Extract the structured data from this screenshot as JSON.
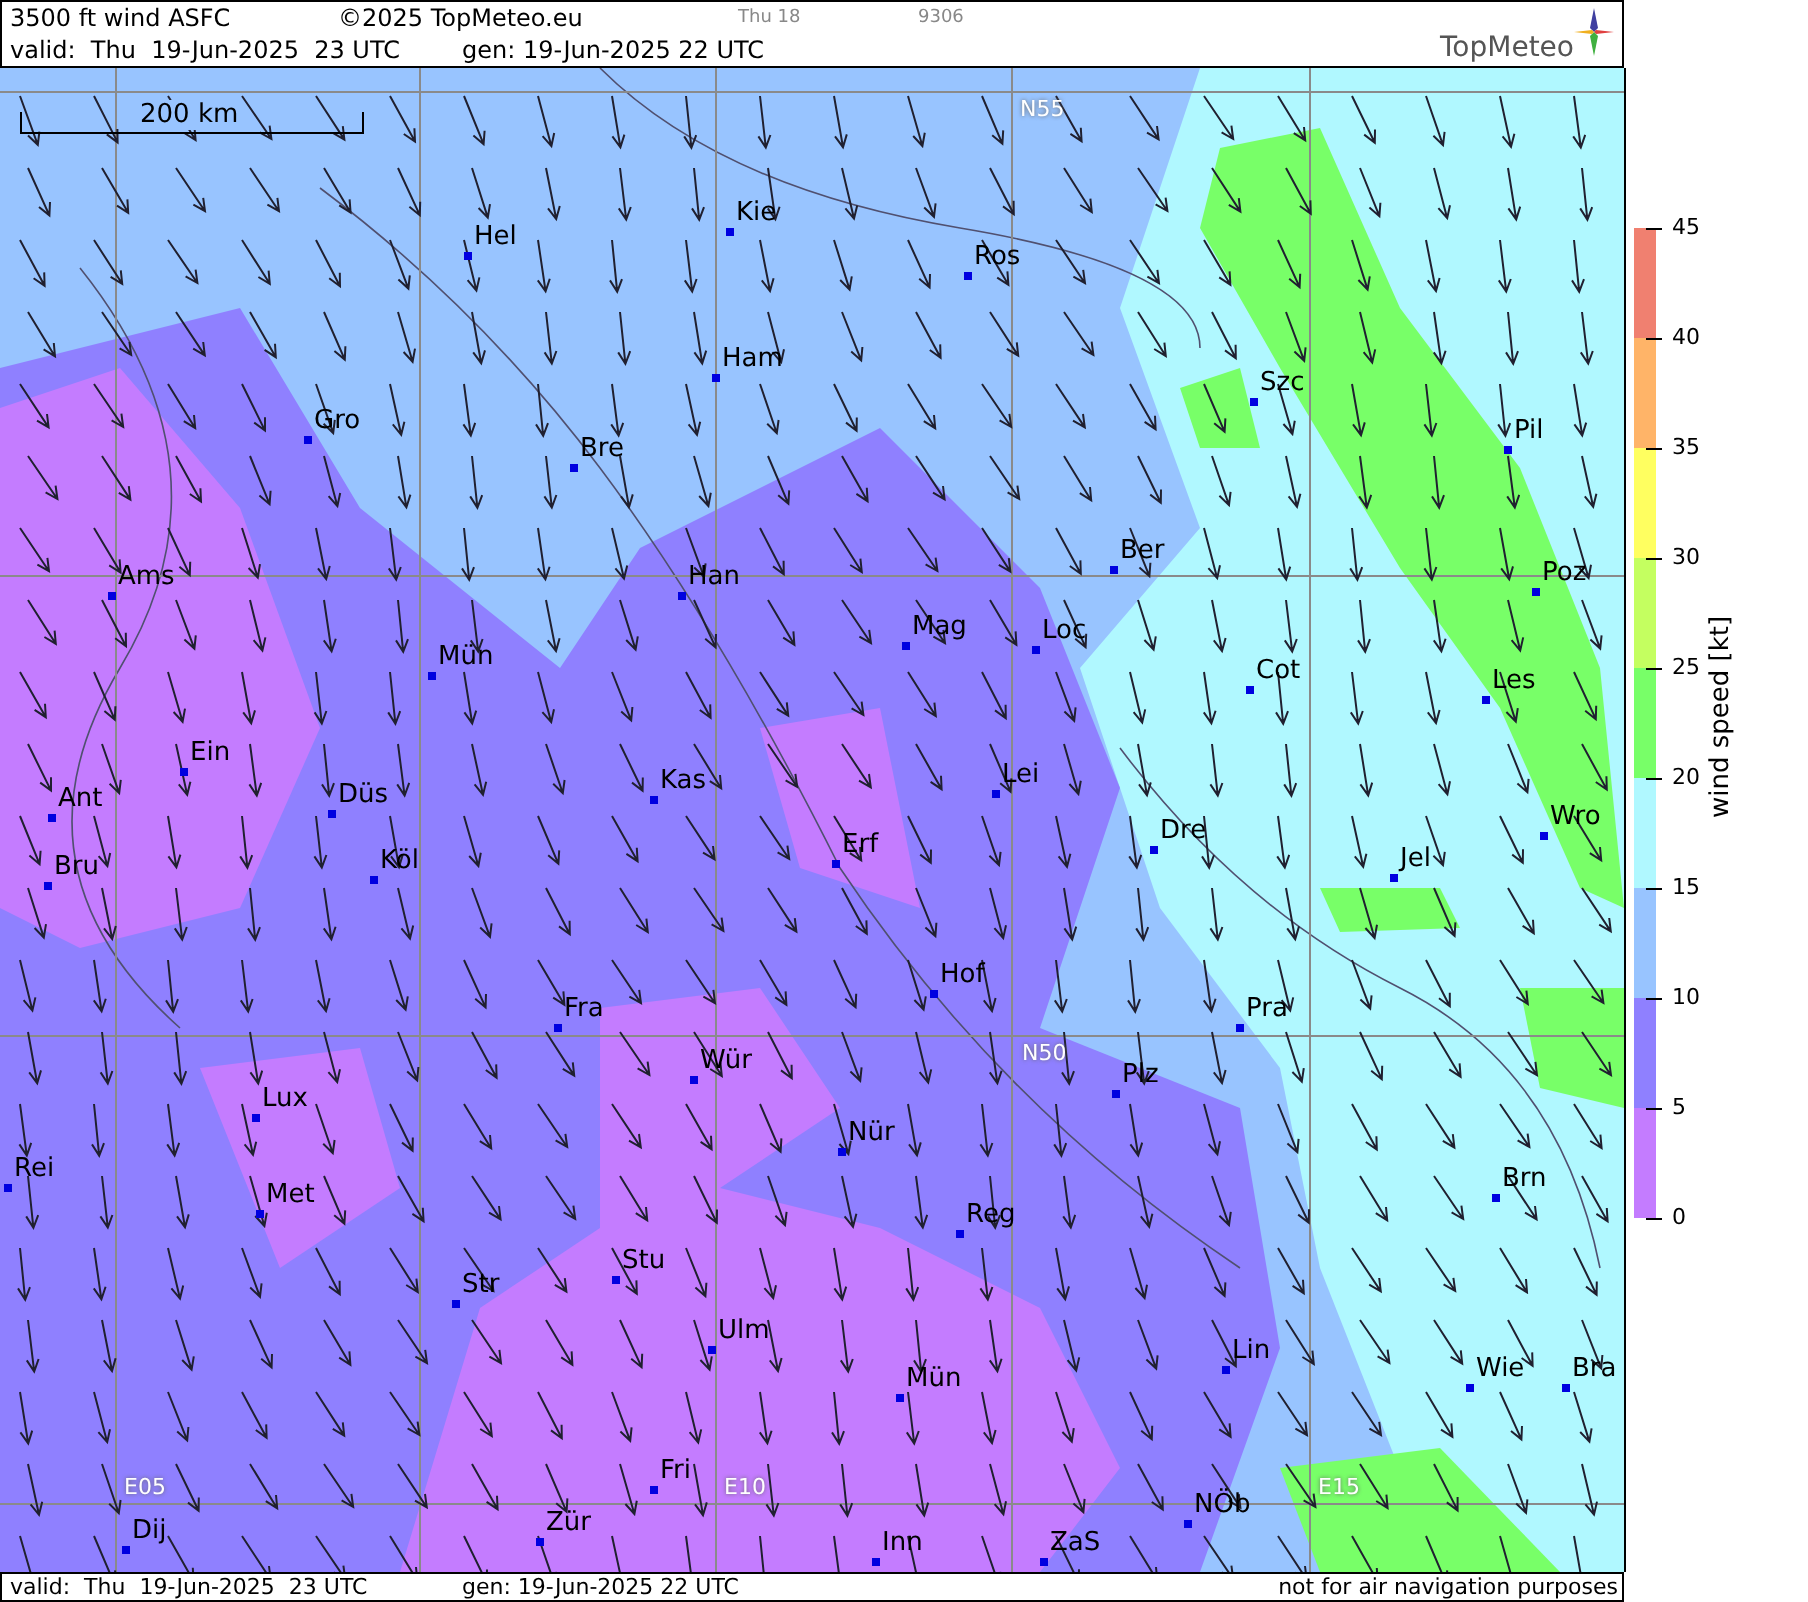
{
  "header": {
    "title": "3500 ft wind ASFC",
    "copyright": "©2025 TopMeteo.eu",
    "day": "Thu 18",
    "code": "9306",
    "valid": "valid:  Thu  19-Jun-2025  23 UTC",
    "generated": "gen: 19-Jun-2025 22 UTC",
    "logo": "TopMeteo"
  },
  "map": {
    "scale": "200 km",
    "grid_labels": [
      {
        "text": "N55"
      },
      {
        "text": "N50"
      },
      {
        "text": "E05"
      },
      {
        "text": "E10"
      },
      {
        "text": "E15"
      }
    ],
    "cities": [
      {
        "name": "Hel"
      },
      {
        "name": "Kie"
      },
      {
        "name": "Ros"
      },
      {
        "name": "Ham"
      },
      {
        "name": "Szc"
      },
      {
        "name": "Gro"
      },
      {
        "name": "Bre"
      },
      {
        "name": "Pil"
      },
      {
        "name": "Ber"
      },
      {
        "name": "Ams"
      },
      {
        "name": "Han"
      },
      {
        "name": "Poz"
      },
      {
        "name": "Mag"
      },
      {
        "name": "Loc"
      },
      {
        "name": "Mün"
      },
      {
        "name": "Cot"
      },
      {
        "name": "Les"
      },
      {
        "name": "Ein"
      },
      {
        "name": "Lei"
      },
      {
        "name": "Kas"
      },
      {
        "name": "Ant"
      },
      {
        "name": "Düs"
      },
      {
        "name": "Wro"
      },
      {
        "name": "Bru"
      },
      {
        "name": "Köl"
      },
      {
        "name": "Erf"
      },
      {
        "name": "Dre"
      },
      {
        "name": "Jel"
      },
      {
        "name": "Hof"
      },
      {
        "name": "Fra"
      },
      {
        "name": "Pra"
      },
      {
        "name": "Wür"
      },
      {
        "name": "Plz"
      },
      {
        "name": "Lux"
      },
      {
        "name": "Nür"
      },
      {
        "name": "Rei"
      },
      {
        "name": "Met"
      },
      {
        "name": "Brn"
      },
      {
        "name": "Reg"
      },
      {
        "name": "Stu"
      },
      {
        "name": "Str"
      },
      {
        "name": "Ulm"
      },
      {
        "name": "Lin"
      },
      {
        "name": "Wie"
      },
      {
        "name": "Bra"
      },
      {
        "name": "Mün"
      },
      {
        "name": "Fri"
      },
      {
        "name": "Zür"
      },
      {
        "name": "Dij"
      },
      {
        "name": "NÖb"
      },
      {
        "name": "Inn"
      },
      {
        "name": "ZaS"
      }
    ]
  },
  "legend": {
    "title": "wind speed [kt]",
    "ticks": [
      {
        "label": "45"
      },
      {
        "label": "40"
      },
      {
        "label": "35"
      },
      {
        "label": "30"
      },
      {
        "label": "25"
      },
      {
        "label": "20"
      },
      {
        "label": "15"
      },
      {
        "label": "10"
      },
      {
        "label": "5"
      },
      {
        "label": "0"
      }
    ],
    "bands": [
      {
        "color": "#f08070"
      },
      {
        "color": "#ffb468"
      },
      {
        "color": "#ffff60"
      },
      {
        "color": "#c4ff60"
      },
      {
        "color": "#78ff68"
      },
      {
        "color": "#b0f8ff"
      },
      {
        "color": "#98c4ff"
      },
      {
        "color": "#8f80ff"
      },
      {
        "color": "#c47cff"
      }
    ]
  },
  "footer": {
    "valid": "valid:  Thu  19-Jun-2025  23 UTC",
    "generated": "gen: 19-Jun-2025 22 UTC",
    "note": "not for air navigation purposes"
  }
}
